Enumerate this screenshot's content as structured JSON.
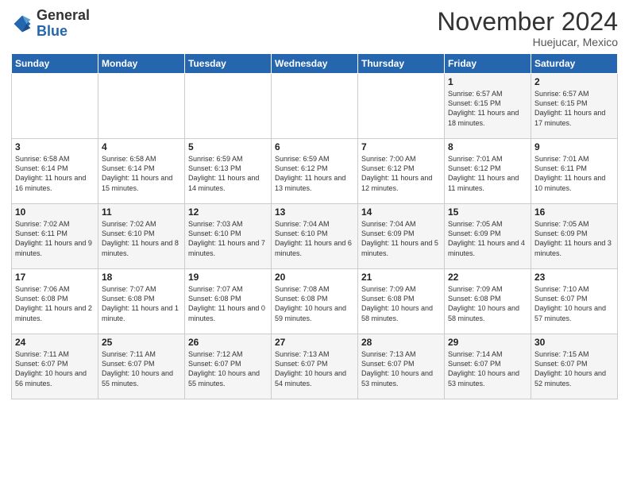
{
  "header": {
    "logo_general": "General",
    "logo_blue": "Blue",
    "month": "November 2024",
    "location": "Huejucar, Mexico"
  },
  "weekdays": [
    "Sunday",
    "Monday",
    "Tuesday",
    "Wednesday",
    "Thursday",
    "Friday",
    "Saturday"
  ],
  "weeks": [
    [
      {
        "day": "",
        "info": ""
      },
      {
        "day": "",
        "info": ""
      },
      {
        "day": "",
        "info": ""
      },
      {
        "day": "",
        "info": ""
      },
      {
        "day": "",
        "info": ""
      },
      {
        "day": "1",
        "info": "Sunrise: 6:57 AM\nSunset: 6:15 PM\nDaylight: 11 hours and 18 minutes."
      },
      {
        "day": "2",
        "info": "Sunrise: 6:57 AM\nSunset: 6:15 PM\nDaylight: 11 hours and 17 minutes."
      }
    ],
    [
      {
        "day": "3",
        "info": "Sunrise: 6:58 AM\nSunset: 6:14 PM\nDaylight: 11 hours and 16 minutes."
      },
      {
        "day": "4",
        "info": "Sunrise: 6:58 AM\nSunset: 6:14 PM\nDaylight: 11 hours and 15 minutes."
      },
      {
        "day": "5",
        "info": "Sunrise: 6:59 AM\nSunset: 6:13 PM\nDaylight: 11 hours and 14 minutes."
      },
      {
        "day": "6",
        "info": "Sunrise: 6:59 AM\nSunset: 6:12 PM\nDaylight: 11 hours and 13 minutes."
      },
      {
        "day": "7",
        "info": "Sunrise: 7:00 AM\nSunset: 6:12 PM\nDaylight: 11 hours and 12 minutes."
      },
      {
        "day": "8",
        "info": "Sunrise: 7:01 AM\nSunset: 6:12 PM\nDaylight: 11 hours and 11 minutes."
      },
      {
        "day": "9",
        "info": "Sunrise: 7:01 AM\nSunset: 6:11 PM\nDaylight: 11 hours and 10 minutes."
      }
    ],
    [
      {
        "day": "10",
        "info": "Sunrise: 7:02 AM\nSunset: 6:11 PM\nDaylight: 11 hours and 9 minutes."
      },
      {
        "day": "11",
        "info": "Sunrise: 7:02 AM\nSunset: 6:10 PM\nDaylight: 11 hours and 8 minutes."
      },
      {
        "day": "12",
        "info": "Sunrise: 7:03 AM\nSunset: 6:10 PM\nDaylight: 11 hours and 7 minutes."
      },
      {
        "day": "13",
        "info": "Sunrise: 7:04 AM\nSunset: 6:10 PM\nDaylight: 11 hours and 6 minutes."
      },
      {
        "day": "14",
        "info": "Sunrise: 7:04 AM\nSunset: 6:09 PM\nDaylight: 11 hours and 5 minutes."
      },
      {
        "day": "15",
        "info": "Sunrise: 7:05 AM\nSunset: 6:09 PM\nDaylight: 11 hours and 4 minutes."
      },
      {
        "day": "16",
        "info": "Sunrise: 7:05 AM\nSunset: 6:09 PM\nDaylight: 11 hours and 3 minutes."
      }
    ],
    [
      {
        "day": "17",
        "info": "Sunrise: 7:06 AM\nSunset: 6:08 PM\nDaylight: 11 hours and 2 minutes."
      },
      {
        "day": "18",
        "info": "Sunrise: 7:07 AM\nSunset: 6:08 PM\nDaylight: 11 hours and 1 minute."
      },
      {
        "day": "19",
        "info": "Sunrise: 7:07 AM\nSunset: 6:08 PM\nDaylight: 11 hours and 0 minutes."
      },
      {
        "day": "20",
        "info": "Sunrise: 7:08 AM\nSunset: 6:08 PM\nDaylight: 10 hours and 59 minutes."
      },
      {
        "day": "21",
        "info": "Sunrise: 7:09 AM\nSunset: 6:08 PM\nDaylight: 10 hours and 58 minutes."
      },
      {
        "day": "22",
        "info": "Sunrise: 7:09 AM\nSunset: 6:08 PM\nDaylight: 10 hours and 58 minutes."
      },
      {
        "day": "23",
        "info": "Sunrise: 7:10 AM\nSunset: 6:07 PM\nDaylight: 10 hours and 57 minutes."
      }
    ],
    [
      {
        "day": "24",
        "info": "Sunrise: 7:11 AM\nSunset: 6:07 PM\nDaylight: 10 hours and 56 minutes."
      },
      {
        "day": "25",
        "info": "Sunrise: 7:11 AM\nSunset: 6:07 PM\nDaylight: 10 hours and 55 minutes."
      },
      {
        "day": "26",
        "info": "Sunrise: 7:12 AM\nSunset: 6:07 PM\nDaylight: 10 hours and 55 minutes."
      },
      {
        "day": "27",
        "info": "Sunrise: 7:13 AM\nSunset: 6:07 PM\nDaylight: 10 hours and 54 minutes."
      },
      {
        "day": "28",
        "info": "Sunrise: 7:13 AM\nSunset: 6:07 PM\nDaylight: 10 hours and 53 minutes."
      },
      {
        "day": "29",
        "info": "Sunrise: 7:14 AM\nSunset: 6:07 PM\nDaylight: 10 hours and 53 minutes."
      },
      {
        "day": "30",
        "info": "Sunrise: 7:15 AM\nSunset: 6:07 PM\nDaylight: 10 hours and 52 minutes."
      }
    ]
  ]
}
